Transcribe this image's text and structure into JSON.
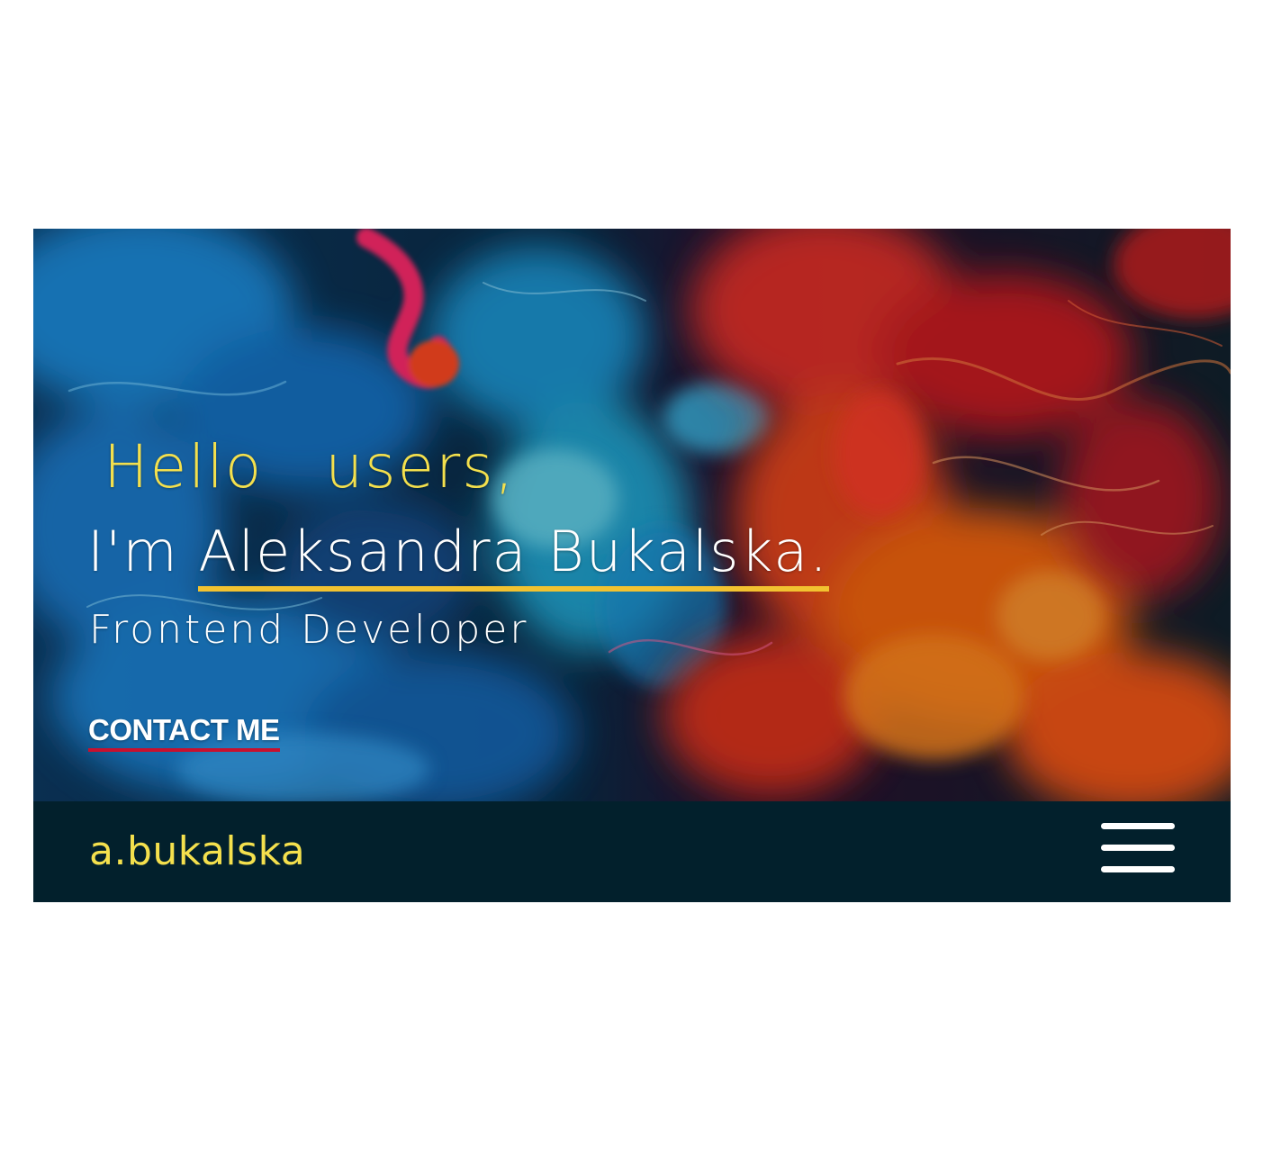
{
  "hero": {
    "greeting_word_1": "Hello",
    "greeting_word_2": "users,",
    "intro_prefix": "I'm ",
    "name": "Aleksandra Bukalska.",
    "role": "Frontend Developer",
    "contact_label": "CONTACT ME"
  },
  "navbar": {
    "logo": "a.bukalska",
    "menu_icon": "hamburger-menu-icon"
  },
  "colors": {
    "accent_yellow": "#f4e04d",
    "name_underline": "#f2c230",
    "contact_underline": "#c8102e",
    "navbar_bg": "#02202c",
    "text_white": "#ffffff"
  }
}
